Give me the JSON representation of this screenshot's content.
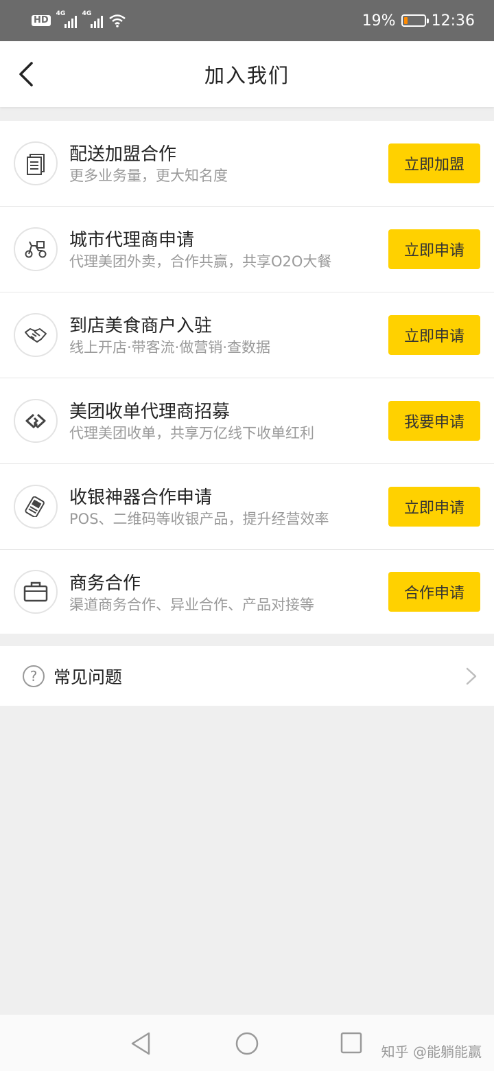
{
  "status_bar": {
    "hd_label": "HD",
    "sim1_label": "4G",
    "sim2_label": "4G",
    "battery_percent": "19%",
    "battery_level": 0.19,
    "time": "12:36"
  },
  "header": {
    "title": "加入我们"
  },
  "items": [
    {
      "title": "配送加盟合作",
      "subtitle": "更多业务量，更大知名度",
      "button": "立即加盟",
      "icon": "document-icon"
    },
    {
      "title": "城市代理商申请",
      "subtitle": "代理美团外卖，合作共赢，共享O2O大餐",
      "button": "立即申请",
      "icon": "scooter-icon"
    },
    {
      "title": "到店美食商户入驻",
      "subtitle": "线上开店·带客流·做营销·查数据",
      "button": "立即申请",
      "icon": "handshake-icon"
    },
    {
      "title": "美团收单代理商招募",
      "subtitle": "代理美团收单，共享万亿线下收单红利",
      "button": "我要申请",
      "icon": "linked-rings-icon"
    },
    {
      "title": "收银神器合作申请",
      "subtitle": "POS、二维码等收银产品，提升经营效率",
      "button": "立即申请",
      "icon": "pos-terminal-icon"
    },
    {
      "title": "商务合作",
      "subtitle": "渠道商务合作、异业合作、产品对接等",
      "button": "合作申请",
      "icon": "briefcase-icon"
    }
  ],
  "faq": {
    "label": "常见问题",
    "icon_glyph": "?"
  },
  "watermark": "知乎 @能躺能赢",
  "colors": {
    "accent_button": "#ffd100",
    "status_bar": "#6b6b6b",
    "background": "#efefef"
  }
}
